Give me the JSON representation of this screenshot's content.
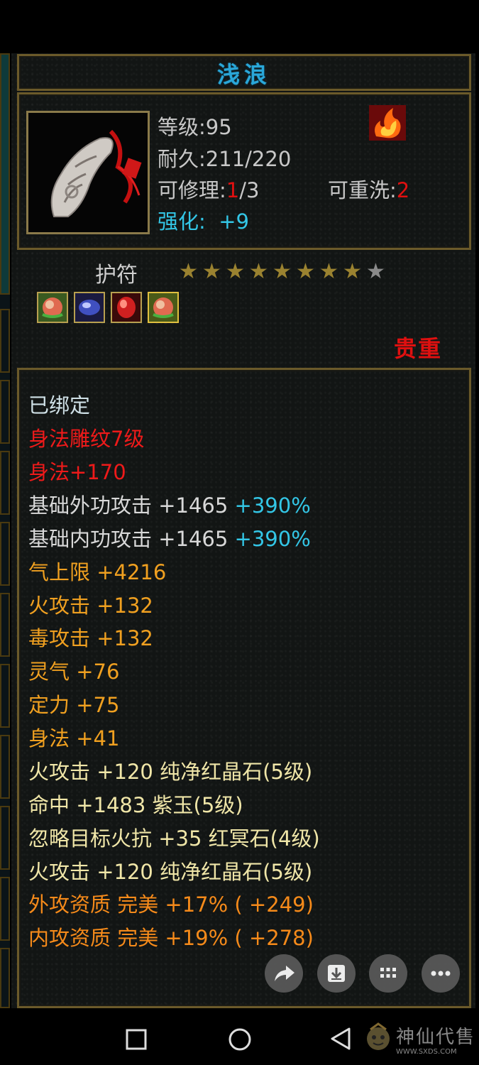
{
  "item": {
    "name": "浅浪",
    "stats": {
      "level_label": "等级",
      "level_value": "95",
      "durability_label": "耐久",
      "durability_value": "211/220",
      "repair_label": "可修理",
      "repair_used": "1",
      "repair_total": "/3",
      "reroll_label": "可重洗",
      "reroll_value": "2",
      "enhance_label": "强化",
      "enhance_value": "+9"
    },
    "type": "护符",
    "stars": {
      "filled": 8,
      "total": 9
    },
    "gems": [
      "green-red-gem-icon",
      "blue-gem-icon",
      "red-gem-icon",
      "green-red-gem-icon"
    ],
    "rarity": "贵重"
  },
  "attributes": [
    {
      "text": "已绑定",
      "color": "white"
    },
    {
      "text": "身法雕纹7级",
      "color": "red"
    },
    {
      "text": "身法+170",
      "color": "red"
    },
    {
      "text": "基础外功攻击 +1465",
      "extra": "+390%",
      "color": "light"
    },
    {
      "text": "基础内功攻击 +1465",
      "extra": "+390%",
      "color": "light"
    },
    {
      "text": "气上限 +4216",
      "color": "orange"
    },
    {
      "text": "火攻击 +132",
      "color": "orange"
    },
    {
      "text": "毒攻击 +132",
      "color": "orange"
    },
    {
      "text": "灵气 +76",
      "color": "orange"
    },
    {
      "text": "定力 +75",
      "color": "orange"
    },
    {
      "text": "身法 +41",
      "color": "orange"
    },
    {
      "text": "火攻击 +120 纯净红晶石(5级)",
      "color": "yellow"
    },
    {
      "text": "命中 +1483 紫玉(5级)",
      "color": "yellow"
    },
    {
      "text": "忽略目标火抗 +35 红冥石(4级)",
      "color": "yellow"
    },
    {
      "text": "火攻击 +120 纯净红晶石(5级)",
      "color": "yellow"
    },
    {
      "text": "外攻资质  完美 +17% ( +249)",
      "color": "orange2"
    },
    {
      "text": "内攻资质  完美 +19% ( +278)",
      "color": "orange2"
    }
  ],
  "actions": [
    "share-icon",
    "download-icon",
    "grid-icon",
    "more-icon"
  ],
  "watermark": {
    "text": "神仙代售",
    "url": "WWW.SXDS.COM"
  },
  "colors": {
    "title": "#2aa7d8",
    "red": "#e01010",
    "cyan": "#33c6e6",
    "star": "#b89a3a"
  }
}
